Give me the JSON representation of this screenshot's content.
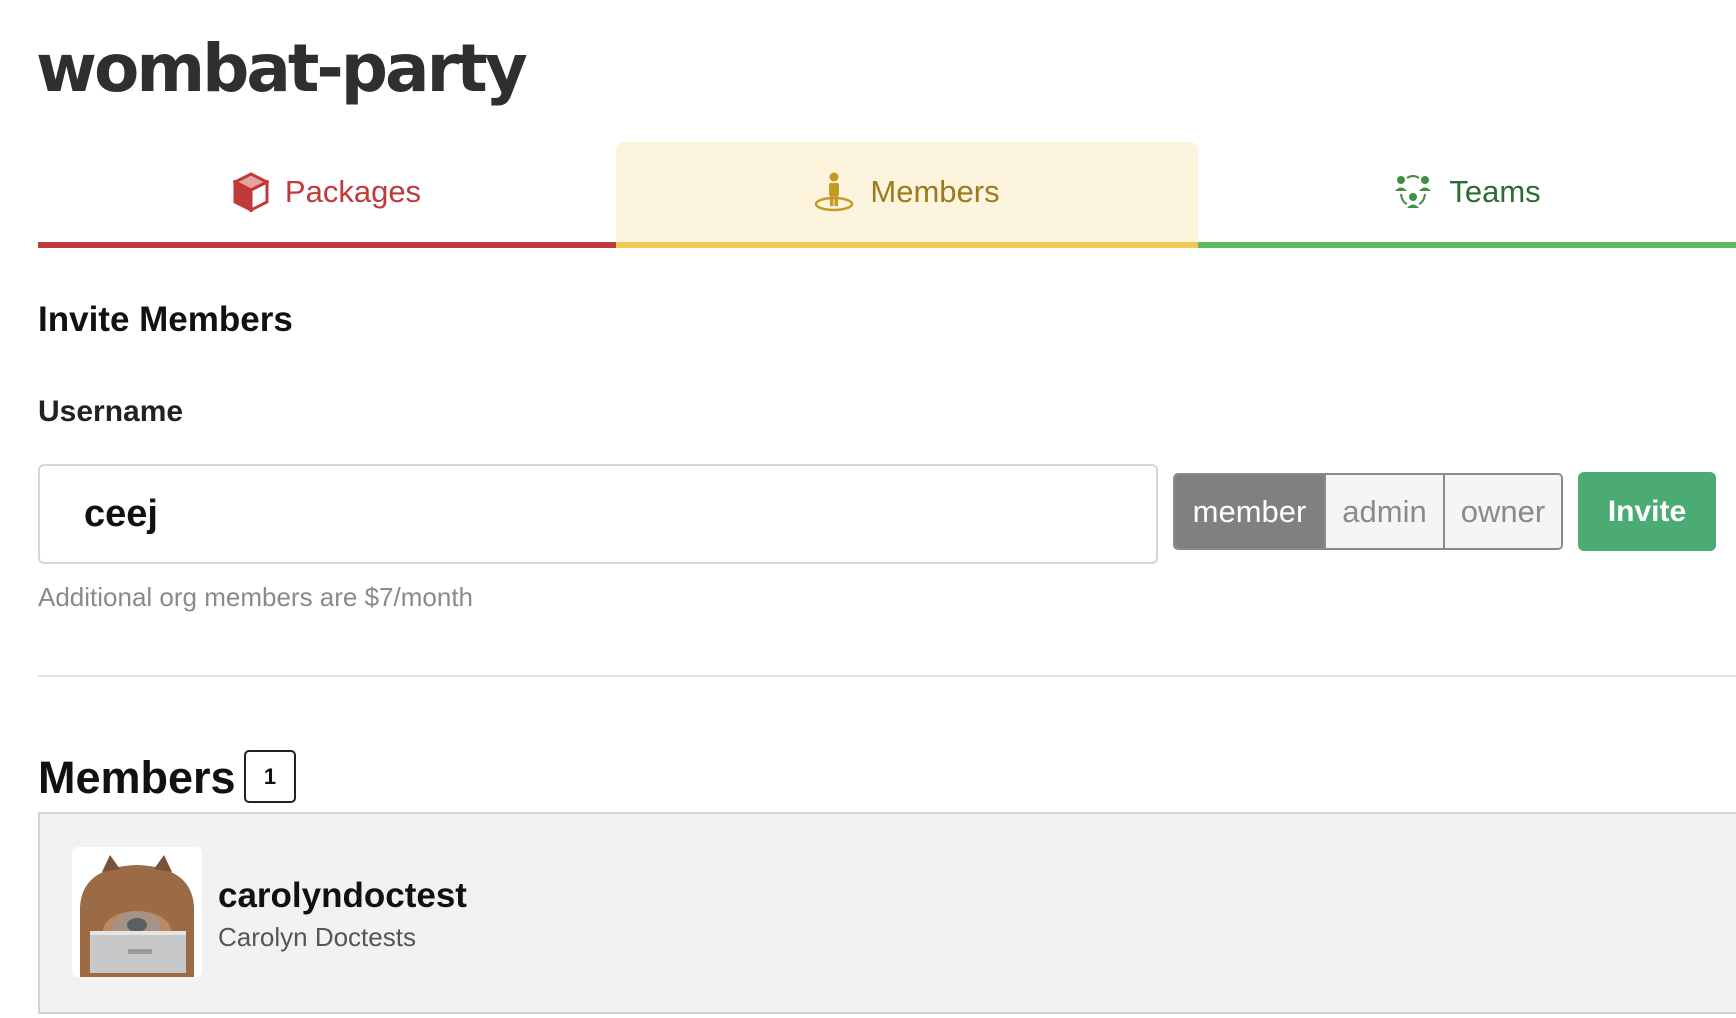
{
  "org": {
    "name": "wombat-party"
  },
  "tabs": [
    {
      "label": "Packages",
      "icon": "package-icon",
      "color": "#c03a39"
    },
    {
      "label": "Members",
      "icon": "member-icon",
      "color": "#9c7a1d",
      "active": true
    },
    {
      "label": "Teams",
      "icon": "teams-icon",
      "color": "#2d6b33"
    }
  ],
  "invite": {
    "heading": "Invite Members",
    "username_label": "Username",
    "username_value": "ceej",
    "roles": [
      "member",
      "admin",
      "owner"
    ],
    "selected_role": "member",
    "button_label": "Invite",
    "price_note": "Additional org members are $7/month"
  },
  "members": {
    "heading": "Members",
    "count": "1",
    "list": [
      {
        "username": "carolyndoctest",
        "full_name": "Carolyn Doctests",
        "avatar": "wombat-avatar"
      }
    ]
  }
}
